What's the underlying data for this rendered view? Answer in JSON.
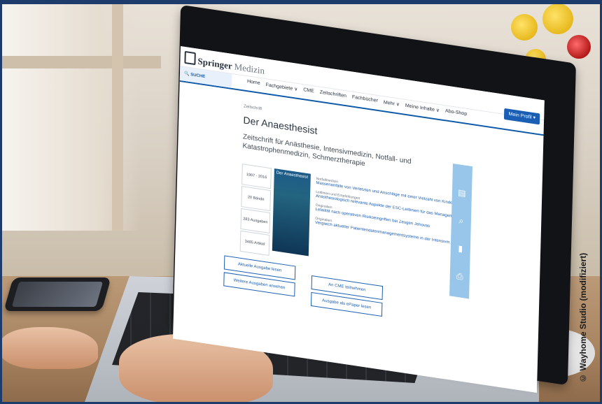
{
  "header": {
    "logo_brand": "Springer",
    "logo_medizin": "Medizin",
    "profile_button": "Mein Profil ▾"
  },
  "nav": {
    "search_label": "SUCHE",
    "items": [
      "Home",
      "Fachgebiete ∨",
      "CME",
      "Zeitschriften",
      "Fachbücher",
      "Mehr ∨",
      "Meine Inhalte ∨",
      "Abo-Shop"
    ]
  },
  "journal": {
    "label": "Zeitschrift",
    "title": "Der Anaesthesist",
    "subtitle": "Zeitschrift für Anästhesie, Intensivmedizin, Notfall- und Katastrophenmedizin, Schmerztherapie",
    "stats": [
      "1997 - 2016",
      "20 Bände",
      "283 Ausgaben",
      "3485 Artikel"
    ],
    "cover_title": "Der Anaesthesist"
  },
  "articles": [
    {
      "kategorie": "Notfallmedizin",
      "title": "Massenanfälle von Verletzten und Anschläge mit einer Vielzahl von Kinde..."
    },
    {
      "kategorie": "Leitlinien und Empfehlungen",
      "title": "Anästhesiologisch relevante Aspekte der ESC-Leitlinien für das Managem..."
    },
    {
      "kategorie": "Originalien",
      "title": "Letalität nach operativen Risikoeingriffen bei Zeugen Jehovas"
    },
    {
      "kategorie": "Originalien",
      "title": "Vergleich aktueller Patientendatenmanagementsysteme in der Intensivm..."
    }
  ],
  "buttons": {
    "current": "Aktuelle Ausgabe lesen",
    "more": "Weitere Ausgaben ansehen",
    "cme": "An CME teilnehmen",
    "epaper": "Ausgabe als ePaper lesen"
  },
  "sidebar_icons": [
    "archive-icon",
    "search-icon",
    "bookmark-icon",
    "print-icon"
  ],
  "credit": "© Wayhome Studio (modifiziert)"
}
